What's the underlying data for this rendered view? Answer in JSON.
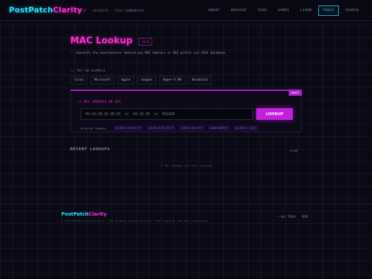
{
  "header": {
    "logo_part1": "PostPatch",
    "logo_part2": "Clarity",
    "tagline": "IT · SECURITY · TECH COMMENTARY",
    "nav": [
      "ABOUT",
      "ARCHIVE",
      "FEED",
      "GAMES",
      "LEARN",
      "TOOLS",
      "SEARCH"
    ],
    "active_nav": "TOOLS"
  },
  "page": {
    "title": "MAC Lookup",
    "version": "v1.0",
    "subtitle_prefix": "//",
    "subtitle": "Identify the manufacturer behind any MAC address or OUI prefix via IEEE database"
  },
  "examples": {
    "label": "// TRY AN EXAMPLE",
    "items": [
      "Cisco",
      "Microsoft",
      "Apple",
      "Google",
      "Hyper-V VM",
      "Broadcast"
    ]
  },
  "lookup": {
    "tag": "QUERY",
    "field_label": "// MAC ADDRESS OR OUI",
    "placeholder": "00:1A:2B:3C:4D:5E  or  00-1A-2B  or  001A2B",
    "button": "LOOKUP",
    "formats_label": "ACCEPTED FORMATS:",
    "formats": [
      "AA:BB:CC:DD:EE:FF",
      "AA-BB-CC-DD-EE-FF",
      "AABB.CCDD.EEFF",
      "AABBCCDDEEFF",
      "AA:BB:CC (OUI)"
    ]
  },
  "recent": {
    "title": "RECENT LOOKUPS",
    "clear": "CLEAR",
    "empty": "// No lookups yet this session"
  },
  "footer": {
    "logo_part1": "PostPatch",
    "logo_part2": "Clarity",
    "copy": "© 2025 PostPatchClarity Tools · OUI database bundled offline · IEEE registry · No data transmitted",
    "links": [
      "← ALL TOOLS",
      "FEED"
    ]
  },
  "colors": {
    "accent_pink": "#ff2bd6",
    "accent_cyan": "#27e3ff",
    "button": "#c41fe0"
  }
}
